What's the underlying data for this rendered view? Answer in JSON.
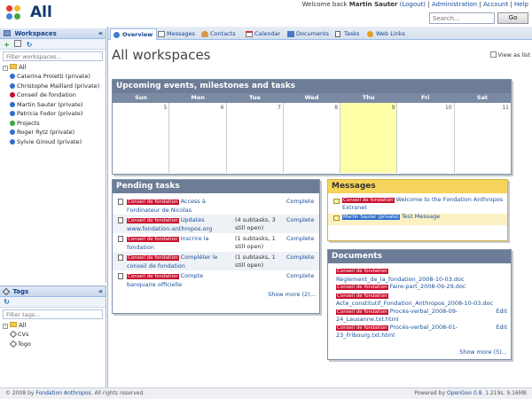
{
  "header": {
    "title": "All",
    "welcome": "Welcome back",
    "user": "Martin Sauter",
    "logout": "(Logout)",
    "sep": "|",
    "administration": "Administration",
    "account": "Account",
    "help": "Help",
    "search_placeholder": "Search...",
    "go_label": "Go"
  },
  "workspaces_panel": {
    "title": "Workspaces",
    "filter_placeholder": "Filter workspaces...",
    "root": "All",
    "items": [
      {
        "label": "Caterina Proietti (private)",
        "color": "#2f6fcf"
      },
      {
        "label": "Christophe Maillard (private)",
        "color": "#2f6fcf"
      },
      {
        "label": "Conseil de fondation",
        "color": "#c8102e"
      },
      {
        "label": "Martin Sauter (private)",
        "color": "#2f6fcf"
      },
      {
        "label": "Patricia Fodor (private)",
        "color": "#2f6fcf"
      },
      {
        "label": "Projects",
        "color": "#3aa836"
      },
      {
        "label": "Roger Rytz (private)",
        "color": "#2f6fcf"
      },
      {
        "label": "Sylvie Giroud (private)",
        "color": "#2f6fcf"
      }
    ]
  },
  "tags_panel": {
    "title": "Tags",
    "filter_placeholder": "Filter tags...",
    "root": "All",
    "items": [
      "CVs",
      "Togo"
    ]
  },
  "tabs": [
    "Overview",
    "Messages",
    "Contacts",
    "Calendar",
    "Documents",
    "Tasks",
    "Web Links"
  ],
  "main": {
    "page_title": "All workspaces",
    "view_as_list": "View as list"
  },
  "calendar": {
    "title": "Upcoming events, milestones and tasks",
    "days": [
      "Sun",
      "Mon",
      "Tue",
      "Wed",
      "Thu",
      "Fri",
      "Sat"
    ],
    "dates": [
      "5",
      "6",
      "7",
      "8",
      "9",
      "10",
      "11"
    ],
    "today_index": 4
  },
  "pending": {
    "title": "Pending tasks",
    "tasks": [
      {
        "ws": "Conseil de fondation",
        "name": "Access à l'ordinateur de Nicolas",
        "sub": "",
        "status": "Complete"
      },
      {
        "ws": "Conseil de fondation",
        "name": "Updates www.fondation-anthropos.org",
        "sub": "(4 subtasks, 3 still open)",
        "status": "Complete"
      },
      {
        "ws": "Conseil de fondation",
        "name": "Inscrire la fondation",
        "sub": "(1 subtasks, 1 still open)",
        "status": "Complete"
      },
      {
        "ws": "Conseil de fondation",
        "name": "Compléter le conseil de fondation",
        "sub": "(1 subtasks, 1 still open)",
        "status": "Complete"
      },
      {
        "ws": "Conseil de fondation",
        "name": "Compte banquaire officielle",
        "sub": "",
        "status": "Complete"
      }
    ],
    "show_more": "Show more (2)..."
  },
  "messages": {
    "title": "Messages",
    "items": [
      {
        "ws": "Conseil de fondation",
        "text": "Welcome to the Fondation Anthropos Extranet"
      },
      {
        "ws": "Martin Sauter (private)",
        "text": "Test Message"
      }
    ]
  },
  "documents": {
    "title": "Documents",
    "items": [
      {
        "ws": "Conseil de fondation",
        "name": "Règlement_de_la_fondation_2008-10-03.doc",
        "edit": ""
      },
      {
        "ws": "Conseil de fondation",
        "name": "Faire-part_2008-09-29.doc",
        "edit": ""
      },
      {
        "ws": "Conseil de fondation",
        "name": "Acte_constitutif_Fondation_Anthropos_2008-10-03.doc",
        "edit": ""
      },
      {
        "ws": "Conseil de fondation",
        "name": "Procès-verbal_2008-09-24_Lausanne.txt.html",
        "edit": "Edit"
      },
      {
        "ws": "Conseil de fondation",
        "name": "Procès-verbal_2008-01-23_Fribourg.txt.html",
        "edit": "Edit"
      }
    ],
    "show_more": "Show more (5)..."
  },
  "footer": {
    "left_prefix": "© 2008 by",
    "left_org": "Fondation Anthropos",
    "left_suffix": ". All rights reserved.",
    "right_prefix": "Powered by",
    "right_product": "OpenGoo 0.8",
    "right_suffix": ". 1.219s. 9.16MB"
  },
  "colors": {
    "accent": "#15428b",
    "widget_header": "#6d7d97",
    "messages_header": "#f6d35a",
    "workspace_badge": "#c8102e",
    "today": "#ffffa8"
  }
}
